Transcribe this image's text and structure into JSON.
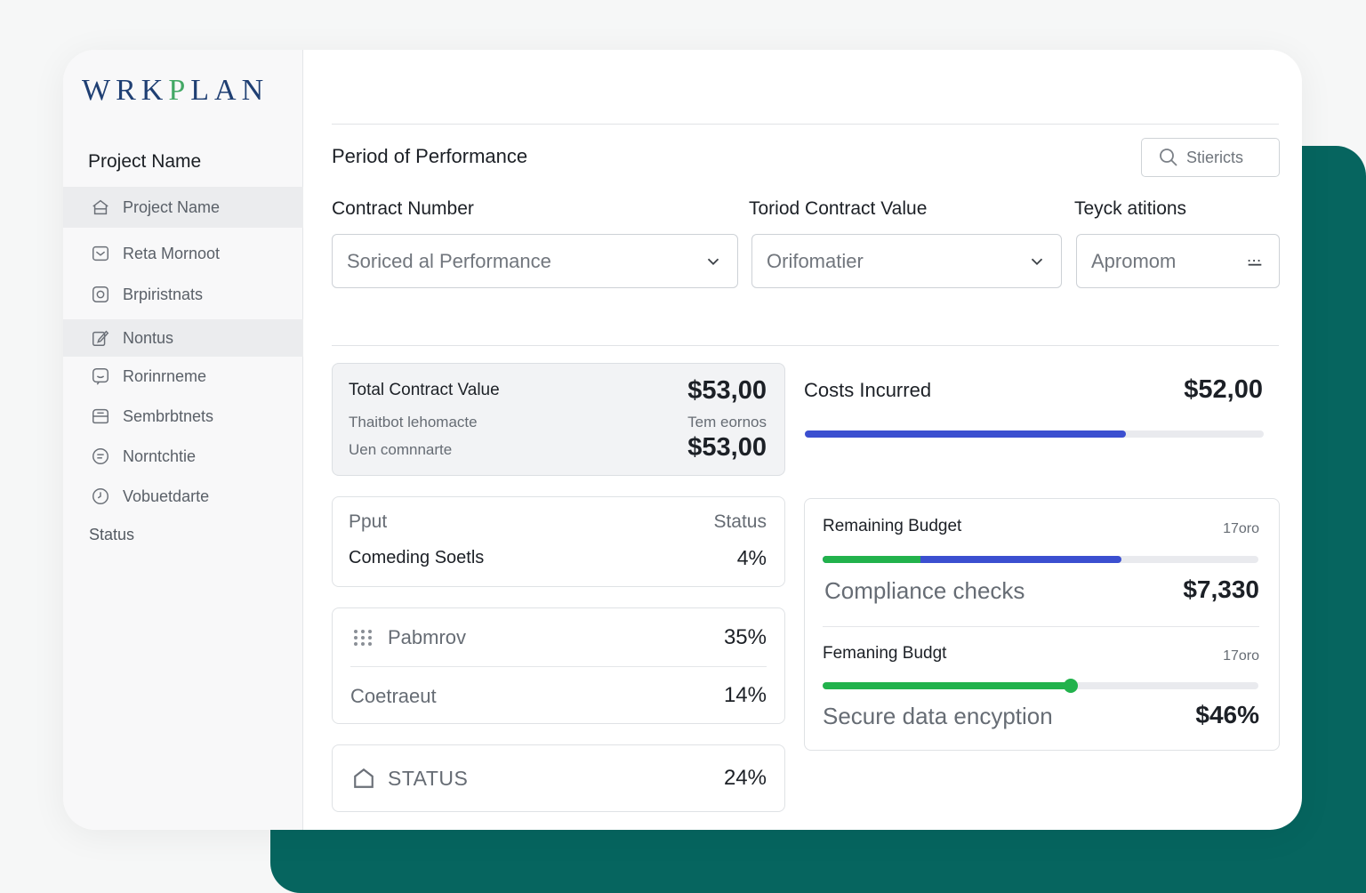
{
  "brand": {
    "logo_prefix": "WRK",
    "logo_accent": "P",
    "logo_suffix": "LAN"
  },
  "colors": {
    "teal": "#06655f",
    "blue": "#3b4fd0",
    "green": "#22b24c",
    "logo_navy": "#1f3f73",
    "logo_green": "#43a865"
  },
  "sidebar": {
    "title": "Project Name",
    "items": [
      {
        "label": "Project Name",
        "icon": "home-icon",
        "active": true
      },
      {
        "label": "Reta Mornoot",
        "icon": "mail-icon",
        "active": false
      },
      {
        "label": "Brpiristnats",
        "icon": "camera-icon",
        "active": false
      },
      {
        "label": "Nontus",
        "icon": "edit-icon",
        "active": true
      },
      {
        "label": "Rorinrneme",
        "icon": "chat-icon",
        "active": false
      },
      {
        "label": "Sembrbtnets",
        "icon": "folder-icon",
        "active": false
      },
      {
        "label": "Norntchtie",
        "icon": "message-icon",
        "active": false
      },
      {
        "label": "Vobuetdarte",
        "icon": "clock-icon",
        "active": false
      }
    ],
    "status_label": "Status"
  },
  "header": {
    "title": "Period of Performance",
    "search_placeholder": "Stiericts"
  },
  "filters": {
    "contract_number": {
      "label": "Contract Number",
      "value": "Soriced al Performance"
    },
    "contract_value": {
      "label": "Toriod Contract Value",
      "value": "Orifomatier"
    },
    "tech": {
      "label": "Teyck atitions",
      "value": "Apromom"
    }
  },
  "total_contract": {
    "title": "Total Contract Value",
    "value": "$53,00",
    "row1_label": "Thaitbot lehomacte",
    "row1_right": "Tem eornos",
    "row2_label": "Uen comnnarte",
    "row2_value": "$53,00"
  },
  "costs_incurred": {
    "label": "Costs Incurred",
    "value": "$52,00",
    "progress": 0.7
  },
  "status_card": {
    "left_header": "Pput",
    "right_header": "Status",
    "row_label": "Comeding Soetls",
    "row_value": "4%"
  },
  "metrics_card": {
    "rows": [
      {
        "label": "Pabmrov",
        "value": "35%",
        "icon": "grid-icon"
      },
      {
        "label": "Coetraeut",
        "value": "14%"
      }
    ]
  },
  "status_bottom": {
    "label": "STATUS",
    "value": "24%"
  },
  "budget_card": {
    "section1": {
      "title": "Remaining Budget",
      "meta": "17oro",
      "green_progress": 0.225,
      "blue_progress": 0.685,
      "sub_label": "Compliance checks",
      "sub_value": "$7,330"
    },
    "section2": {
      "title": "Femaning Budgt",
      "meta": "17oro",
      "green_progress": 0.57,
      "sub_label": "Secure data encyption",
      "sub_value": "$46%"
    }
  }
}
